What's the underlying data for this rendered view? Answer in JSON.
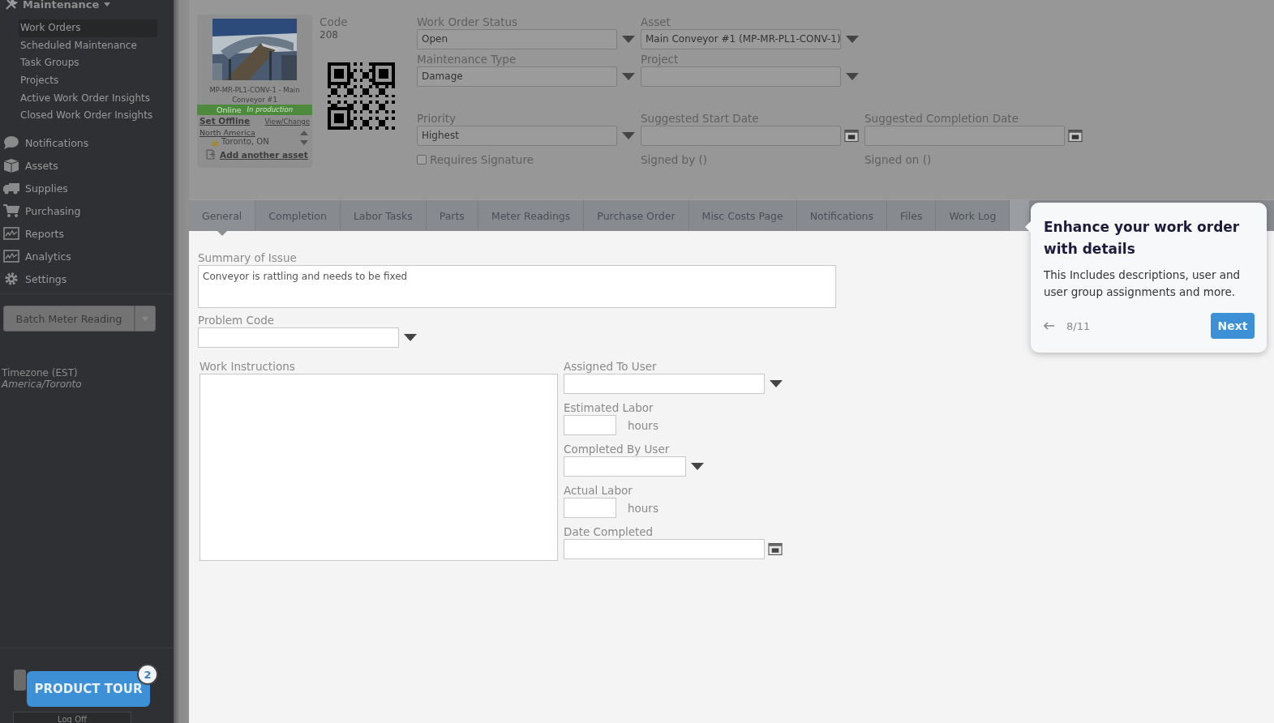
{
  "sidebar": {
    "section": "Maintenance",
    "items": [
      {
        "label": "Work Orders",
        "selected": true
      },
      {
        "label": "Scheduled Maintenance",
        "selected": false
      },
      {
        "label": "Task Groups",
        "selected": false
      },
      {
        "label": "Projects",
        "selected": false
      },
      {
        "label": "Active Work Order Insights",
        "selected": false
      },
      {
        "label": "Closed Work Order Insights",
        "selected": false
      }
    ],
    "nav": [
      {
        "label": "Notifications",
        "kind": "chat"
      },
      {
        "label": "Assets",
        "kind": "box"
      },
      {
        "label": "Supplies",
        "kind": "truck"
      },
      {
        "label": "Purchasing",
        "kind": "cart"
      },
      {
        "label": "Reports",
        "kind": "chart"
      },
      {
        "label": "Analytics",
        "kind": "chart"
      },
      {
        "label": "Settings",
        "kind": "gear"
      }
    ],
    "batch_button": "Batch Meter Reading",
    "timezone_label": "Timezone (EST)",
    "timezone_value": "America/Toronto",
    "log_off": "Log Off"
  },
  "asset_card": {
    "name": "MP-MR-PL1-CONV-1 - Main Conveyor #1",
    "status": "Online",
    "status_note": "In production",
    "set_offline": "Set Offline",
    "view_change": "View/Change",
    "location": "North America",
    "sublocation": "Toronto, ON",
    "add_asset": "Add another asset"
  },
  "code": {
    "label": "Code",
    "value": "208"
  },
  "header_rows": [
    [
      {
        "kind": "select",
        "label": "Work Order Status",
        "value": "Open"
      },
      {
        "kind": "select",
        "label": "Asset",
        "value": "Main Conveyor #1 (MP-MR-PL1-CONV-1)"
      }
    ],
    [
      {
        "kind": "select",
        "label": "Maintenance Type",
        "value": "Damage"
      },
      {
        "kind": "select",
        "label": "Project"
      }
    ],
    [
      {
        "kind": "select",
        "label": "Priority",
        "value": "Highest"
      },
      {
        "kind": "date",
        "label": "Suggested Start Date"
      },
      {
        "kind": "date",
        "label": "Suggested Completion Date"
      }
    ],
    [
      {
        "kind": "checkbox",
        "label": "Requires Signature",
        "checked": false
      },
      {
        "kind": "text",
        "label": "Signed by ()"
      },
      {
        "kind": "text",
        "label": "Signed on ()"
      }
    ]
  ],
  "tabs": [
    {
      "label": "General",
      "selected": true
    },
    {
      "label": "Completion",
      "selected": false
    },
    {
      "label": "Labor Tasks",
      "selected": false
    },
    {
      "label": "Parts",
      "selected": false
    },
    {
      "label": "Meter Readings",
      "selected": false
    },
    {
      "label": "Purchase Order",
      "selected": false
    },
    {
      "label": "Misc Costs Page",
      "selected": false
    },
    {
      "label": "Notifications",
      "selected": false
    },
    {
      "label": "Files",
      "selected": false
    },
    {
      "label": "Work Log",
      "selected": false
    }
  ],
  "general": {
    "summary_label": "Summary of Issue",
    "summary_value": "Conveyor is rattling and needs to be fixed",
    "problem_code_label": "Problem Code",
    "instructions_label": "Work Instructions",
    "right_fields": [
      {
        "kind": "select",
        "label": "Assigned To User"
      },
      {
        "kind": "labor",
        "label": "Estimated Labor",
        "unit": "hours"
      },
      {
        "kind": "select",
        "label": "Completed By User"
      },
      {
        "kind": "labor",
        "label": "Actual Labor",
        "unit": "hours"
      },
      {
        "kind": "date",
        "label": "Date Completed"
      }
    ]
  },
  "tour": {
    "title": "Enhance your work order with details",
    "body": "This Includes descriptions, user and user group assignments and more.",
    "step": "8/11",
    "next": "Next"
  },
  "product_tour": {
    "label": "PRODUCT TOUR",
    "badge": "2"
  }
}
